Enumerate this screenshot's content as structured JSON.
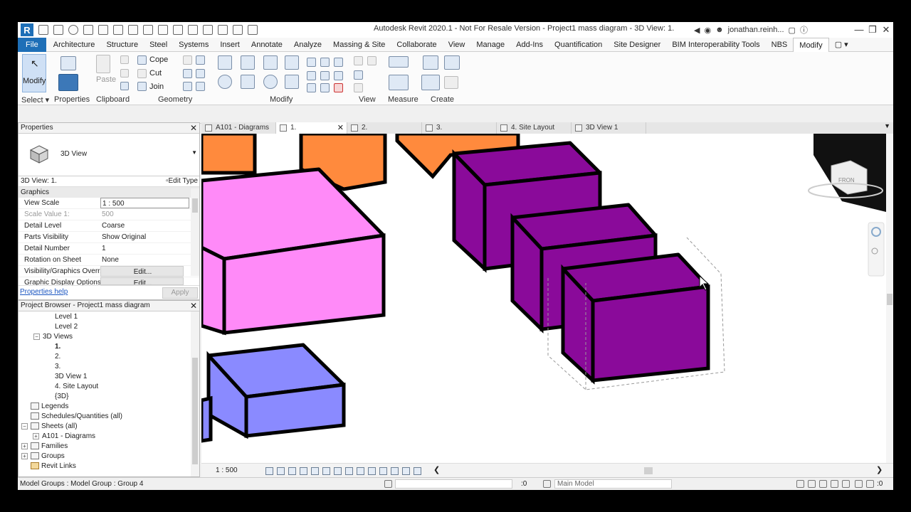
{
  "titlebar": {
    "logo": "R",
    "title": "Autodesk Revit 2020.1 - Not For Resale Version - Project1 mass diagram - 3D View: 1.",
    "user": "jonathan.reinh...",
    "minimize": "—",
    "restore": "❐",
    "close": "✕"
  },
  "ribbon_tabs": [
    "File",
    "Architecture",
    "Structure",
    "Steel",
    "Systems",
    "Insert",
    "Annotate",
    "Analyze",
    "Massing & Site",
    "Collaborate",
    "View",
    "Manage",
    "Add-Ins",
    "Quantification",
    "Site Designer",
    "BIM Interoperability Tools",
    "NBS",
    "Modify"
  ],
  "ribbon_active_tab": "Modify",
  "ribbon": {
    "modify_label": "Modify",
    "paste_label": "Paste",
    "cope_label": "Cope",
    "cut_label": "Cut",
    "join_label": "Join",
    "panels": {
      "select": "Select",
      "properties": "Properties",
      "clipboard": "Clipboard",
      "geometry": "Geometry",
      "modify": "Modify",
      "view": "View",
      "measure": "Measure",
      "create": "Create"
    }
  },
  "properties": {
    "title": "Properties",
    "type_name": "3D View",
    "instance_label": "3D View: 1.",
    "edit_type": "Edit Type",
    "category": "Graphics",
    "rows": [
      {
        "name": "View Scale",
        "value": "1 : 500"
      },
      {
        "name": "Scale Value    1:",
        "value": "500"
      },
      {
        "name": "Detail Level",
        "value": "Coarse"
      },
      {
        "name": "Parts Visibility",
        "value": "Show Original"
      },
      {
        "name": "Detail Number",
        "value": "1"
      },
      {
        "name": "Rotation on Sheet",
        "value": "None"
      },
      {
        "name": "Visibility/Graphics Overr...",
        "value": "Edit..."
      },
      {
        "name": "Graphic Display Options",
        "value": "Edit..."
      }
    ],
    "help_link": "Properties help",
    "apply": "Apply"
  },
  "browser": {
    "title": "Project Browser - Project1 mass diagram",
    "items": [
      {
        "label": "Level 1"
      },
      {
        "label": "Level 2"
      },
      {
        "label": "3D Views",
        "toggle": "−"
      },
      {
        "label": "1.",
        "bold": true
      },
      {
        "label": "2."
      },
      {
        "label": "3."
      },
      {
        "label": "3D View 1"
      },
      {
        "label": "4. Site Layout"
      },
      {
        "label": "{3D}"
      },
      {
        "label": "Legends"
      },
      {
        "label": "Schedules/Quantities (all)"
      },
      {
        "label": "Sheets (all)",
        "toggle": "−"
      },
      {
        "label": "A101 - Diagrams",
        "toggle": "+"
      },
      {
        "label": "Families",
        "toggle": "+"
      },
      {
        "label": "Groups",
        "toggle": "+"
      },
      {
        "label": "Revit Links"
      }
    ]
  },
  "view_tabs": [
    {
      "label": "A101 - Diagrams",
      "active": false
    },
    {
      "label": "1.",
      "active": true
    },
    {
      "label": "2.",
      "active": false
    },
    {
      "label": "3.",
      "active": false
    },
    {
      "label": "4. Site Layout",
      "active": false
    },
    {
      "label": "3D View 1",
      "active": false
    }
  ],
  "viewcube": {
    "face": "FRON"
  },
  "colors": {
    "orange": "#ff8a3d",
    "pink": "#ff8af8",
    "purple": "#8a0a9a",
    "blue": "#8a8aff",
    "accent": "#1e6fb7"
  },
  "view_control": {
    "scale": "1 : 500"
  },
  "status": {
    "text": "Model Groups : Model Group : Group 4",
    "zero": ":0",
    "model": "Main Model",
    "filter_count": ":0"
  }
}
